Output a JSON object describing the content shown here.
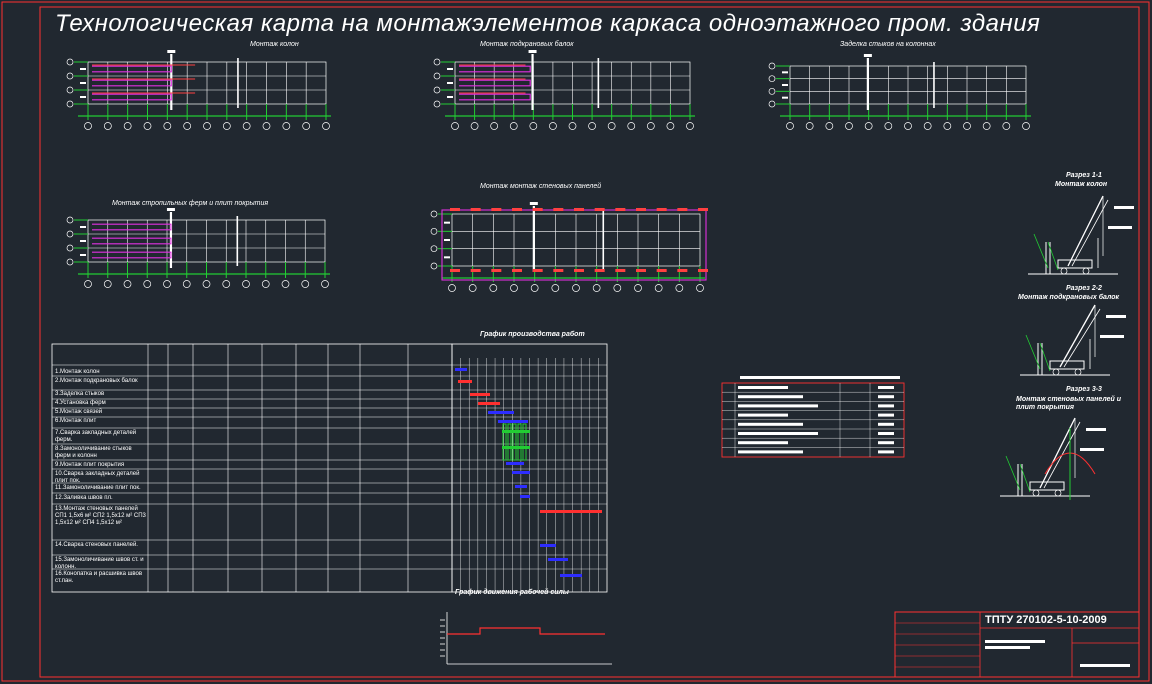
{
  "title": "Технологическая карта на монтажэлементов каркаса одноэтажного пром. здания",
  "views": {
    "columns": "Монтаж колон",
    "crane_beams": "Монтаж подкрановых балок",
    "fill_joints": "Заделка стыков на колоннах",
    "trusses": "Монтаж стропильных ферм и плит покрытия",
    "wall_panels": "Монтаж монтаж стеновых панелей",
    "schedule": "График производства работ",
    "worker_chart": "График движения рабочей силы"
  },
  "sections": [
    {
      "title": "Разрез 1-1",
      "subtitle": "Монтаж колон"
    },
    {
      "title": "Разрез 2-2",
      "subtitle": "Монтаж подкрановых балок"
    },
    {
      "title": "Разрез 3-3",
      "subtitle": "Монтаж стеновых панелей и плит покрытия"
    }
  ],
  "schedule_rows": [
    "1.Монтаж колон",
    "2.Монтаж подкрановых балок",
    "3.Заделка стыков",
    "4.Установка ферм",
    "5.Монтаж связей",
    "6.Монтаж плит",
    "7.Сварка закладных деталей ферм.",
    "8.Замоноличивание стыков ферм и колонн",
    "9.Монтаж плит покрытия",
    "10.Сварка закладных деталей плит пок.",
    "11.Замоноличивание плит пок.",
    "12.Заливка швов пл.",
    "13.Монтаж стеновых панелей  СП1 1,5x6 м²  СП2 1,5x12 м²  СП3 1,5x12 м²  СП4 1,5x12 м²",
    "14.Сварка стеновых панелей.",
    "15.Замоноличивание швов ст. и колонн.",
    "16.Конопатка и расшивка швов ст.пан."
  ],
  "stamp": {
    "code": "ТПТУ 270102-5-10-2009"
  }
}
